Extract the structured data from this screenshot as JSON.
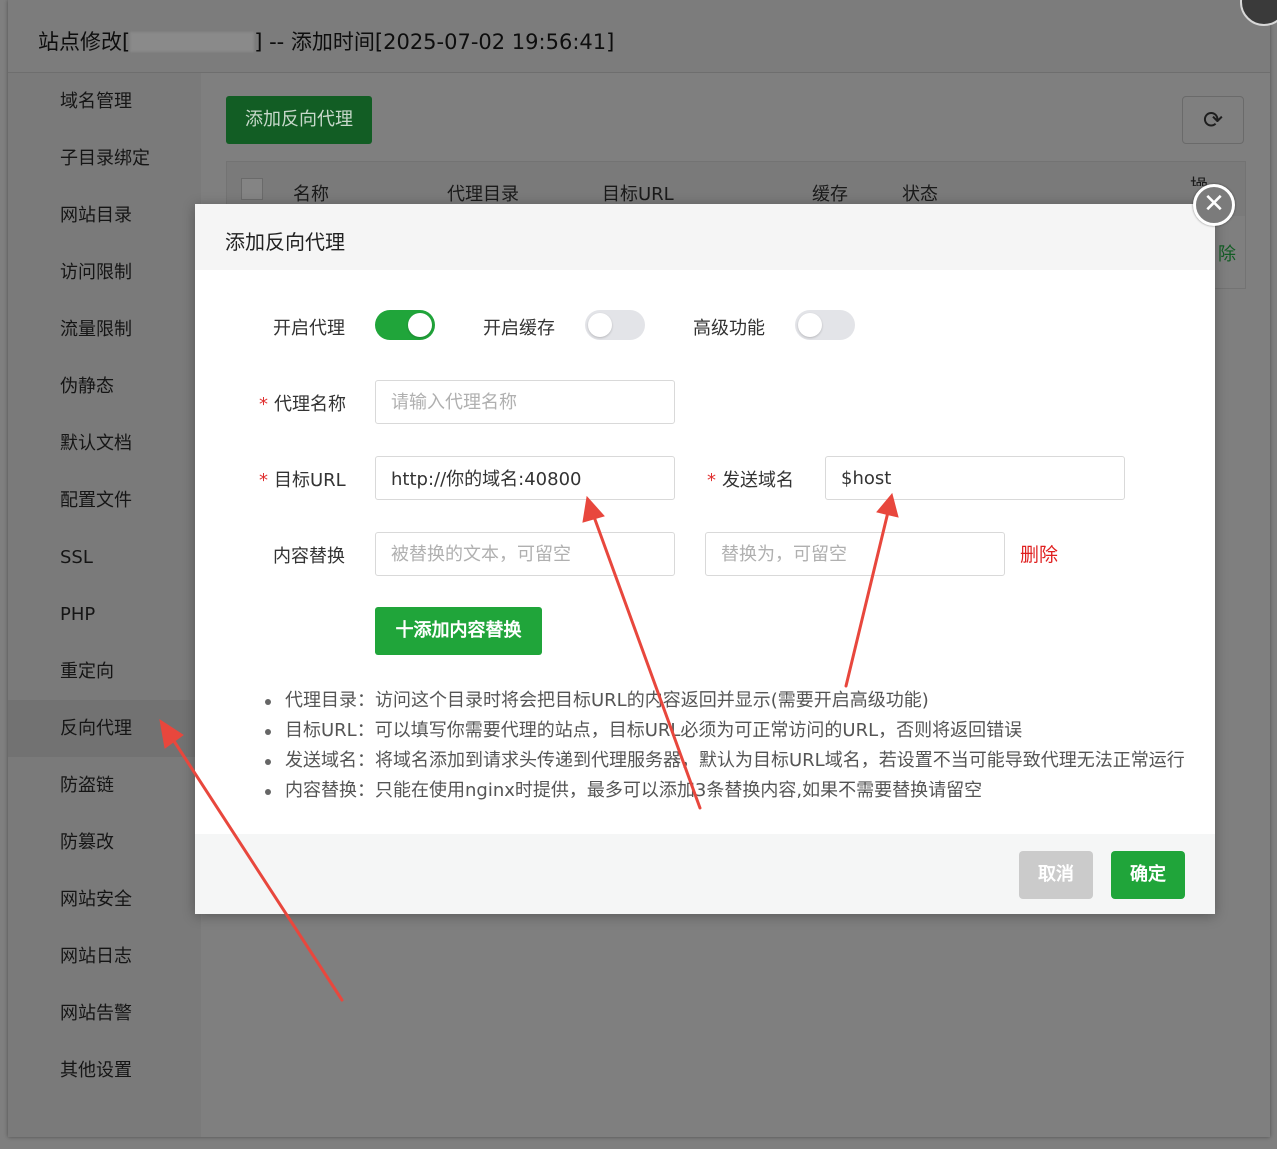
{
  "window": {
    "title_prefix": "站点修改[",
    "title_suffix": "] -- 添加时间[2025-07-02 19:56:41]"
  },
  "sidebar": {
    "items": [
      {
        "label": "域名管理"
      },
      {
        "label": "子目录绑定"
      },
      {
        "label": "网站目录"
      },
      {
        "label": "访问限制"
      },
      {
        "label": "流量限制"
      },
      {
        "label": "伪静态"
      },
      {
        "label": "默认文档"
      },
      {
        "label": "配置文件"
      },
      {
        "label": "SSL"
      },
      {
        "label": "PHP"
      },
      {
        "label": "重定向"
      },
      {
        "label": "反向代理",
        "active": true
      },
      {
        "label": "防盗链"
      },
      {
        "label": "防篡改"
      },
      {
        "label": "网站安全"
      },
      {
        "label": "网站日志"
      },
      {
        "label": "网站告警"
      },
      {
        "label": "其他设置"
      }
    ]
  },
  "background": {
    "add_button": "添加反向代理",
    "refresh_icon": "refresh-icon",
    "table_headers": [
      "名称",
      "代理目录",
      "目标URL",
      "缓存",
      "状态"
    ],
    "partial_header": "操作",
    "partial_action": "除"
  },
  "modal": {
    "title": "添加反向代理",
    "toggles": [
      {
        "label": "开启代理",
        "on": true
      },
      {
        "label": "开启缓存",
        "on": false
      },
      {
        "label": "高级功能",
        "on": false
      }
    ],
    "required_mark": "*",
    "proxy_name": {
      "label": "代理名称",
      "placeholder": "请输入代理名称",
      "value": ""
    },
    "target_url": {
      "label": "目标URL",
      "value": "http://你的域名:40800"
    },
    "send_domain": {
      "label": "发送域名",
      "value": "$host"
    },
    "content_replace": {
      "label": "内容替换",
      "from_placeholder": "被替换的文本，可留空",
      "to_placeholder": "替换为，可留空",
      "delete_label": "删除"
    },
    "add_content_button": "十添加内容替换",
    "tips": [
      "代理目录：访问这个目录时将会把目标URL的内容返回并显示(需要开启高级功能)",
      "目标URL：可以填写你需要代理的站点，目标URL必须为可正常访问的URL，否则将返回错误",
      "发送域名：将域名添加到请求头传递到代理服务器，默认为目标URL域名，若设置不当可能导致代理无法正常运行",
      "内容替换：只能在使用nginx时提供，最多可以添加3条替换内容,如果不需要替换请留空"
    ],
    "cancel_button": "取消",
    "ok_button": "确定",
    "close_icon": "close-icon"
  },
  "colors": {
    "primary_green": "#20a53a",
    "danger_red": "#e02020",
    "annotation_red": "#e8473d"
  }
}
